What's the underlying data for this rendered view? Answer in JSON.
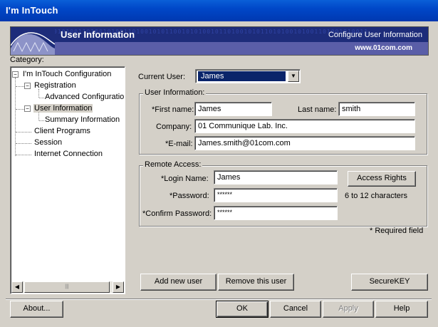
{
  "window": {
    "title": "I'm InTouch"
  },
  "banner": {
    "binary": "0101001101001010011010010101100101010010110100101011010100101001101001010011",
    "title": "User Information",
    "subtitle": "Configure User Information",
    "url": "www.01com.com"
  },
  "category": {
    "label": "Category:",
    "items": [
      {
        "label": "I'm InTouch Configuration"
      },
      {
        "label": "Registration"
      },
      {
        "label": "Advanced Configuratio"
      },
      {
        "label": "User Information"
      },
      {
        "label": "Summary Information"
      },
      {
        "label": "Client Programs"
      },
      {
        "label": "Session"
      },
      {
        "label": "Internet Connection"
      }
    ],
    "toggle_expanded": "−",
    "scroll_left": "◀",
    "scroll_right": "▶",
    "scroll_grip": "|||"
  },
  "current_user": {
    "label": "Current User:",
    "value": "James",
    "arrow": "▼"
  },
  "user_info": {
    "group_label": "User Information:",
    "first_name_label": "*First name:",
    "first_name": "James",
    "last_name_label": "Last name:",
    "last_name": "smith",
    "company_label": "Company:",
    "company": "01 Communique Lab. Inc.",
    "email_label": "*E-mail:",
    "email": "James.smith@01com.com"
  },
  "remote_access": {
    "group_label": "Remote Access:",
    "login_name_label": "*Login Name:",
    "login_name": "James",
    "access_rights_label": "Access Rights",
    "password_label": "*Password:",
    "password": "******",
    "password_hint": "6 to 12 characters",
    "confirm_password_label": "*Confirm Password:",
    "confirm_password": "******"
  },
  "required_note": "* Required field",
  "buttons": {
    "add_user": "Add new user",
    "remove_user": "Remove this user",
    "securekey": "SecureKEY",
    "about": "About...",
    "ok": "OK",
    "cancel": "Cancel",
    "apply": "Apply",
    "help": "Help"
  }
}
